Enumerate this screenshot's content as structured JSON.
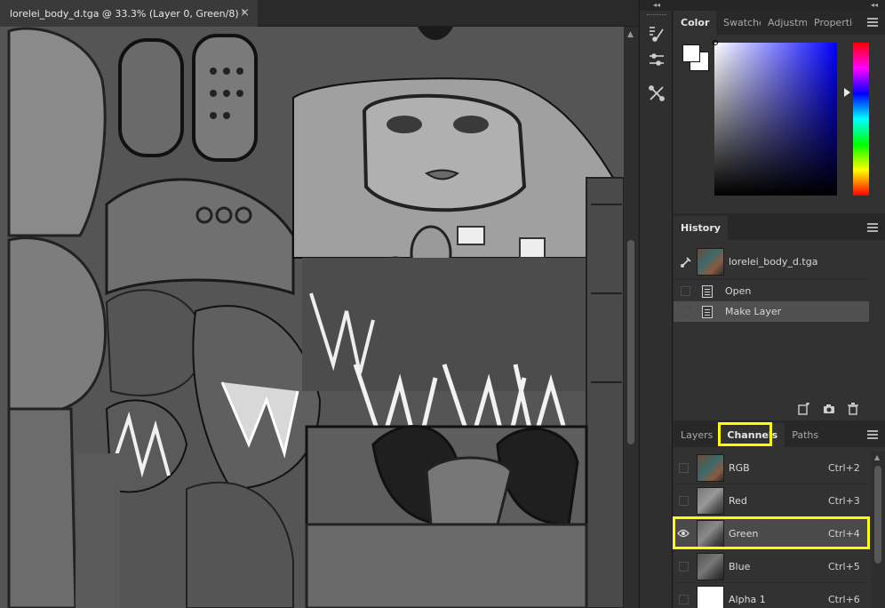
{
  "document": {
    "tab_title": "lorelei_body_d.tga @ 33.3% (Layer 0, Green/8) *",
    "close_glyph": "×"
  },
  "tool_strip": {
    "tools": [
      {
        "name": "brush-presets-icon"
      },
      {
        "name": "brush-settings-icon"
      },
      {
        "name": "tool-presets-icon"
      }
    ]
  },
  "color_panel": {
    "tabs": [
      "Color",
      "Swatches",
      "Adjustments",
      "Properties"
    ],
    "active_tab": "Color",
    "hue_accent": "#0000ff",
    "foreground": "#ffffff",
    "background": "#ffffff"
  },
  "history_panel": {
    "title": "History",
    "snapshot": "lorelei_body_d.tga",
    "states": [
      {
        "label": "Open"
      },
      {
        "label": "Make Layer"
      }
    ]
  },
  "channels_panel": {
    "tabs": [
      "Layers",
      "Channels",
      "Paths"
    ],
    "active_tab": "Channels",
    "channels": [
      {
        "name": "RGB",
        "shortcut": "Ctrl+2",
        "visible": false
      },
      {
        "name": "Red",
        "shortcut": "Ctrl+3",
        "visible": false
      },
      {
        "name": "Green",
        "shortcut": "Ctrl+4",
        "visible": true
      },
      {
        "name": "Blue",
        "shortcut": "Ctrl+5",
        "visible": false
      },
      {
        "name": "Alpha 1",
        "shortcut": "Ctrl+6",
        "visible": false
      }
    ]
  },
  "highlight_color": "#ffff00"
}
